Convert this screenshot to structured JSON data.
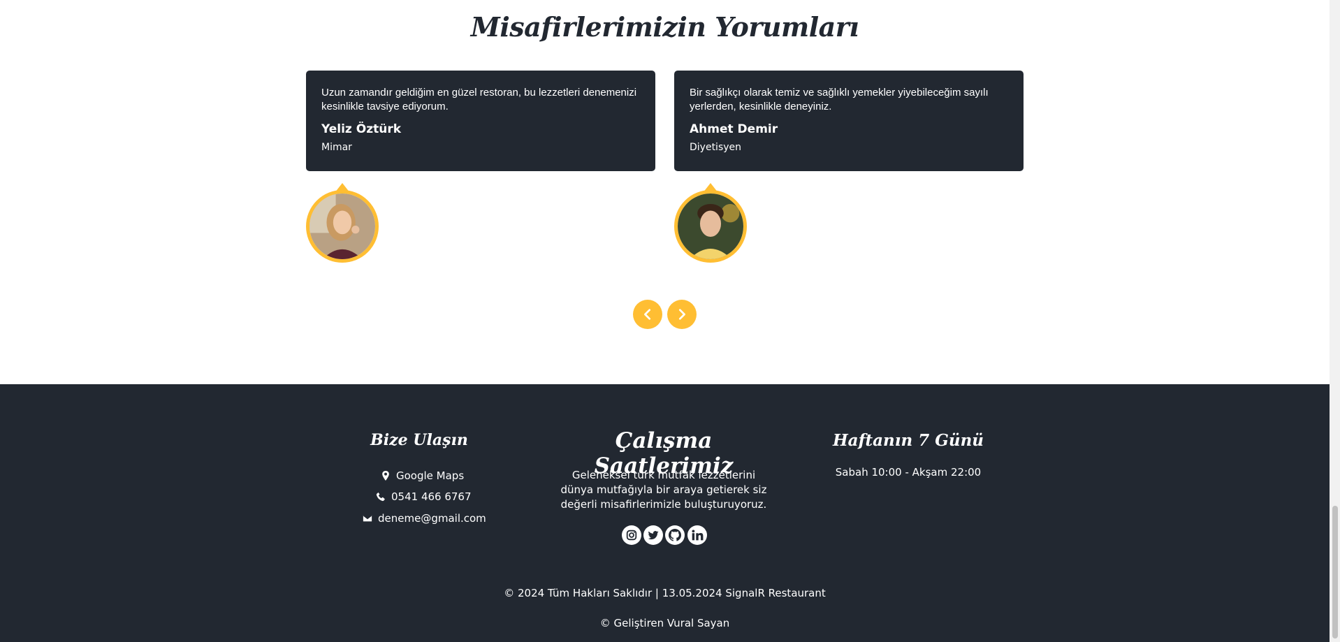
{
  "testimonials": {
    "title": "Misafirlerimizin Yorumları",
    "items": [
      {
        "quote": "Uzun zamandır geldiğim en güzel restoran, bu lezzetleri denemenizi kesinlikle tavsiye ediyorum.",
        "name": "Yeliz Öztürk",
        "role": "Mimar"
      },
      {
        "quote": "Bir sağlıkçı olarak temiz ve sağlıklı yemekler yiyebileceğim sayılı yerlerden, kesinlikle deneyiniz.",
        "name": "Ahmet Demir",
        "role": "Diyetisyen"
      }
    ],
    "prev_icon": "chevron-left-icon",
    "next_icon": "chevron-right-icon"
  },
  "footer": {
    "contact": {
      "title": "Bize Ulaşın",
      "items": [
        {
          "icon": "map-marker-icon",
          "label": "Google Maps"
        },
        {
          "icon": "phone-icon",
          "label": "0541 466 6767"
        },
        {
          "icon": "envelope-icon",
          "label": "deneme@gmail.com"
        }
      ]
    },
    "about": {
      "title": "Çalışma Saatlerimiz",
      "text": "Geleneksel türk mutfak lezzetlerini dünya mutfağıyla bir araya getierek siz değerli misafirlerimizle buluşturuyoruz.",
      "social": [
        "instagram-icon",
        "twitter-icon",
        "github-icon",
        "linkedin-icon"
      ]
    },
    "hours": {
      "title": "Haftanın 7 Günü",
      "text": "Sabah 10:00 - Akşam 22:00"
    },
    "copyright": "© 2024 Tüm Hakları Saklıdır | 13.05.2024 SignalR Restaurant",
    "developer": "© Geliştiren Vural Sayan"
  },
  "colors": {
    "accent": "#ffbe33",
    "dark": "#222831",
    "white": "#ffffff"
  }
}
